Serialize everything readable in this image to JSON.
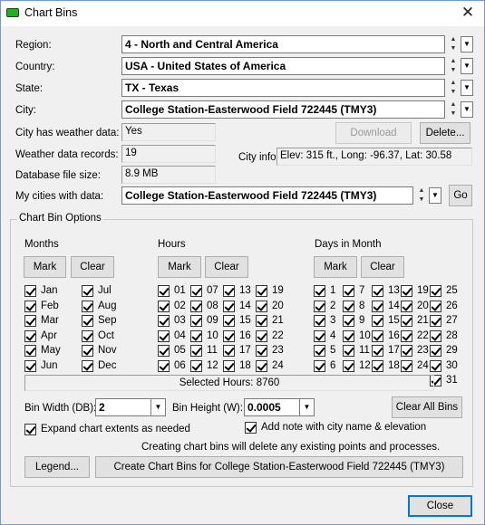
{
  "window": {
    "title": "Chart Bins",
    "close_glyph": "✕"
  },
  "location": {
    "region_label": "Region:",
    "region_value": "4 - North and Central America",
    "country_label": "Country:",
    "country_value": "USA - United States of America",
    "state_label": "State:",
    "state_value": "TX - Texas",
    "city_label": "City:",
    "city_value": "College Station-Easterwood Field 722445 (TMY3)",
    "has_data_label": "City has weather data:",
    "has_data_value": "Yes",
    "records_label": "Weather data records:",
    "records_value": "19",
    "db_size_label": "Database file size:",
    "db_size_value": "8.9 MB",
    "my_cities_label": "My cities with data:",
    "my_cities_value": "College Station-Easterwood Field 722445 (TMY3)",
    "city_info_label": "City info:",
    "city_info_value": "Elev: 315 ft., Long: -96.37, Lat: 30.58",
    "download_label": "Download",
    "delete_label": "Delete...",
    "go_label": "Go"
  },
  "options": {
    "group_title": "Chart Bin Options",
    "months_title": "Months",
    "hours_title": "Hours",
    "days_title": "Days in Month",
    "mark_label": "Mark",
    "clear_label": "Clear",
    "months_col1": [
      "Jan",
      "Feb",
      "Mar",
      "Apr",
      "May",
      "Jun"
    ],
    "months_col2": [
      "Jul",
      "Aug",
      "Sep",
      "Oct",
      "Nov",
      "Dec"
    ],
    "hours_cols": [
      [
        "01",
        "02",
        "03",
        "04",
        "05",
        "06"
      ],
      [
        "07",
        "08",
        "09",
        "10",
        "11",
        "12"
      ],
      [
        "13",
        "14",
        "15",
        "16",
        "17",
        "18"
      ],
      [
        "19",
        "20",
        "21",
        "22",
        "23",
        "24"
      ]
    ],
    "days_cols": [
      [
        "1",
        "2",
        "3",
        "4",
        "5",
        "6"
      ],
      [
        "7",
        "8",
        "9",
        "10",
        "11",
        "12"
      ],
      [
        "13",
        "14",
        "15",
        "16",
        "17",
        "18"
      ],
      [
        "19",
        "20",
        "21",
        "22",
        "23",
        "24"
      ],
      [
        "25",
        "26",
        "27",
        "28",
        "29",
        "30",
        "31"
      ]
    ],
    "selected_hours": "Selected Hours: 8760",
    "bin_width_label": "Bin Width (DB):",
    "bin_width_value": "2",
    "bin_height_label": "Bin Height (W):",
    "bin_height_value": "0.0005",
    "clear_all_bins_label": "Clear All Bins",
    "expand_label": "Expand chart extents as needed",
    "add_note_label": "Add note with city name & elevation",
    "warning": "Creating chart bins will delete any existing points and processes.",
    "legend_label": "Legend...",
    "create_label": "Create Chart Bins for College Station-Easterwood Field 722445 (TMY3)"
  },
  "footer": {
    "close_label": "Close"
  }
}
